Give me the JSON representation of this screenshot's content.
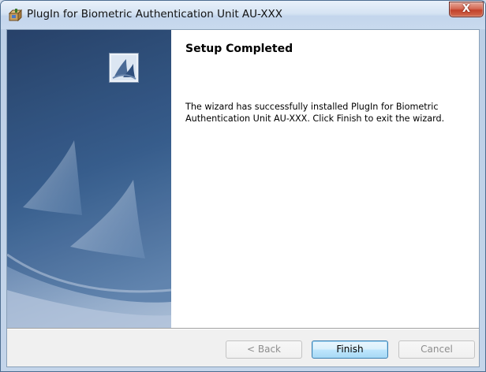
{
  "window": {
    "title": "PlugIn for Biometric Authentication Unit AU-XXX",
    "close_label": "X"
  },
  "content": {
    "heading": "Setup Completed",
    "description": "The wizard has successfully installed PlugIn for Biometric Authentication Unit AU-XXX. Click Finish to exit the wizard."
  },
  "buttons": {
    "back_label": "< Back",
    "finish_label": "Finish",
    "cancel_label": "Cancel"
  },
  "colors": {
    "side_panel_dark": "#233d66",
    "side_panel_light": "#c9d6e8",
    "default_button_border": "#3c7fb1"
  },
  "icons": {
    "title": "installer-box-icon",
    "logo": "setup-logo-icon",
    "close": "close-icon"
  }
}
